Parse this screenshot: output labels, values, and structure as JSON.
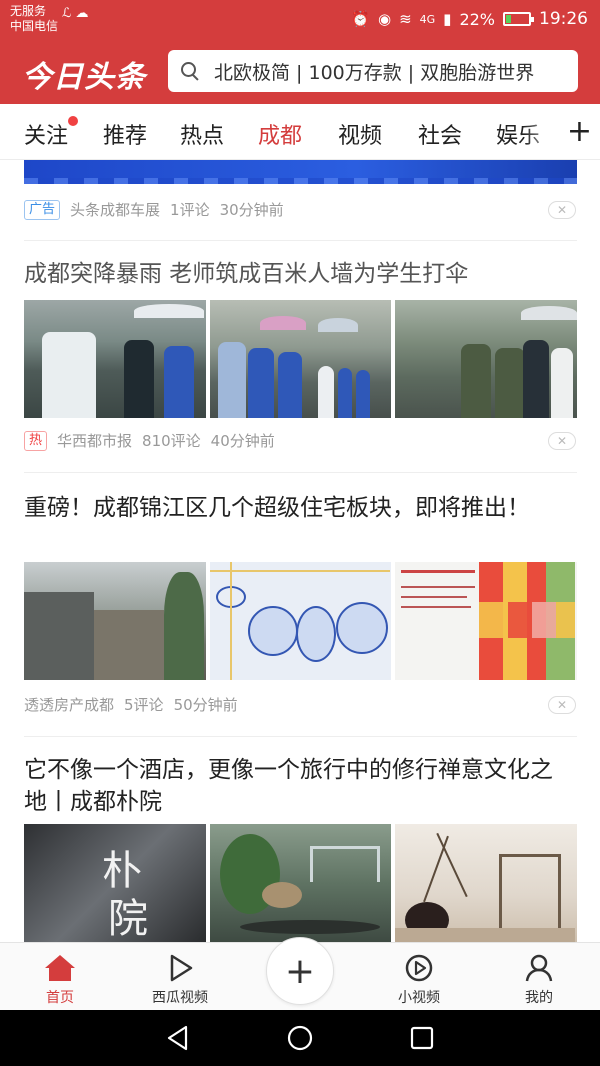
{
  "status_bar": {
    "carrier_line1": "无服务",
    "carrier_line2": "中国电信",
    "carrier_extra": "ℒ ☁",
    "network": "4G",
    "battery_percent": "22%",
    "battery_level": 0.22,
    "time": "19:26"
  },
  "header": {
    "logo": "今日头条",
    "search_placeholder": "北欧极简 | 100万存款 | 双胞胎游世界"
  },
  "channels": {
    "items": [
      "关注",
      "推荐",
      "热点",
      "成都",
      "视频",
      "社会",
      "娱乐"
    ],
    "active": "成都",
    "add_label": "+"
  },
  "feed": {
    "ad": {
      "badge": "广告",
      "source": "头条成都车展",
      "comments": "1评论",
      "time": "30分钟前",
      "dismiss": "✕"
    },
    "articles": [
      {
        "title": "成都突降暴雨 老师筑成百米人墙为学生打伞",
        "badge": "热",
        "source": "华西都市报",
        "comments": "810评论",
        "time": "40分钟前",
        "dismiss": "✕"
      },
      {
        "title": "重磅！成都锦江区几个超级住宅板块，即将推出！",
        "source": "透透房产成都",
        "comments": "5评论",
        "time": "50分钟前",
        "dismiss": "✕"
      },
      {
        "title": "它不像一个酒店，更像一个旅行中的修行禅意文化之地丨成都朴院"
      }
    ]
  },
  "bottom_nav": {
    "items": [
      {
        "label": "首页",
        "icon": "home-icon"
      },
      {
        "label": "西瓜视频",
        "icon": "play-icon"
      },
      {
        "label": "",
        "icon": "plus-icon"
      },
      {
        "label": "小视频",
        "icon": "short-video-icon"
      },
      {
        "label": "我的",
        "icon": "person-icon"
      }
    ],
    "active_color": "#d43d3d"
  },
  "system_nav": {
    "buttons": [
      "back-icon",
      "home-circle-icon",
      "recent-apps-icon"
    ]
  },
  "colors": {
    "brand_red": "#d43d3d",
    "text": "#222222",
    "meta": "#999999"
  }
}
